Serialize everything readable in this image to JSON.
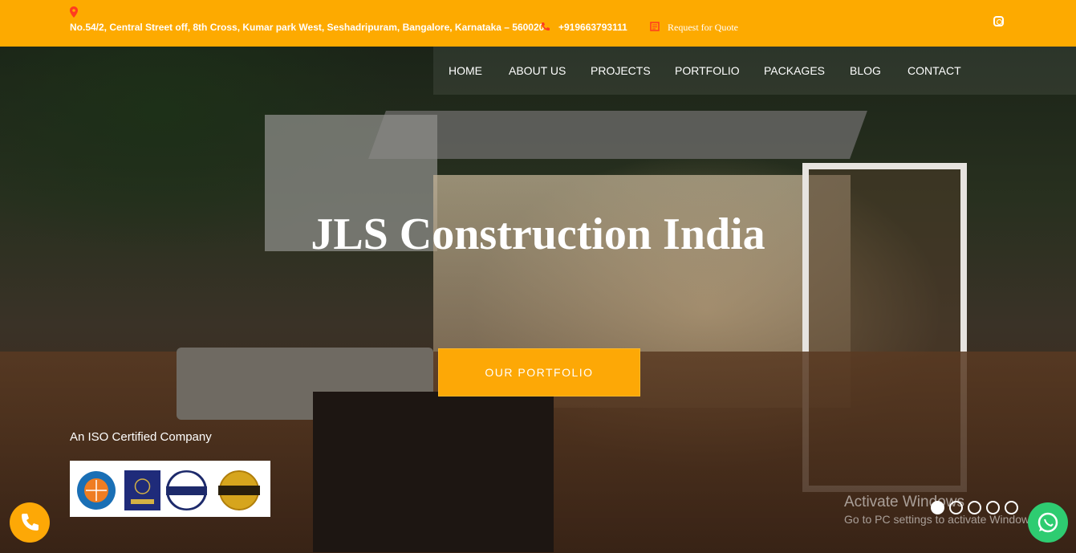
{
  "topbar": {
    "address": "No.54/2, Central Street off, 8th Cross, Kumar park West, Seshadripuram, Bangalore, Karnataka – 560020",
    "phone": "+919663793111",
    "quote": "Request for Quote",
    "icons": [
      "map-pin-icon",
      "phone-icon",
      "quote-icon",
      "instagram-icon"
    ]
  },
  "nav": {
    "items": [
      "HOME",
      "ABOUT US",
      "PROJECTS",
      "PORTFOLIO",
      "PACKAGES",
      "BLOG",
      "CONTACT"
    ]
  },
  "hero": {
    "headline": "JLS Construction India",
    "cta": "OUR PORTFOLIO",
    "iso_text": "An ISO Certified Company",
    "badges": [
      "QUALITY CONTROL",
      "UASL",
      "CERTIFIED",
      "ISO 9001:2015"
    ],
    "slides": {
      "count": 5,
      "active": 1
    }
  },
  "watermark": {
    "line1": "Activate Windows",
    "line2": "Go to PC settings to activate Windows."
  },
  "colors": {
    "accent": "#fdaa00",
    "whatsapp": "#2ecc71"
  }
}
